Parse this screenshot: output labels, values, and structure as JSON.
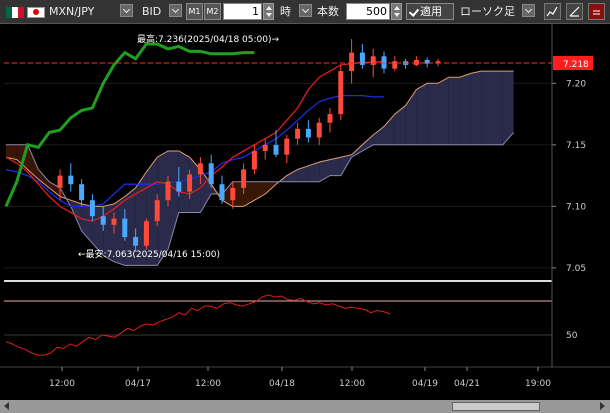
{
  "toolbar": {
    "symbol": "MXN/JPY",
    "price_type": "BID",
    "m1_label": "M1",
    "m2_label": "M2",
    "interval_value": "1",
    "interval_unit": "時",
    "count_label": "本数",
    "count_value": "500",
    "apply_label": "適用",
    "chart_type": "ローソク足"
  },
  "colors": {
    "background": "#000000",
    "up_candle": "#ff4a3a",
    "down_candle": "#4aa8ff",
    "chikou": "#1ea01e",
    "kijun": "#1c2ee0",
    "tenkan": "#e01c1c",
    "cloud_bear": "#3a1608",
    "cloud_bull": "#2a2a4a",
    "price_tag": "#ff1e1e"
  },
  "chart_data": [
    {
      "type": "line",
      "price_axis": {
        "ylim": [
          7.045,
          7.245
        ],
        "ticks": [
          "7.20",
          "7.15",
          "7.10",
          "7.05"
        ]
      },
      "current_price": "7.218",
      "annotations": {
        "high": "最高:7.236(2025/04/18 05:00)→",
        "low": "←最安:7.063(2025/04/16 15:00)"
      },
      "time_axis": {
        "labels": [
          "12:00",
          "04/17",
          "12:00",
          "04/18",
          "12:00",
          "04/19",
          "04/21",
          "19:00"
        ]
      },
      "candles": [
        [
          7.115,
          7.13,
          7.105,
          7.125
        ],
        [
          7.125,
          7.135,
          7.112,
          7.118
        ],
        [
          7.118,
          7.122,
          7.1,
          7.105
        ],
        [
          7.105,
          7.11,
          7.088,
          7.092
        ],
        [
          7.092,
          7.1,
          7.08,
          7.085
        ],
        [
          7.085,
          7.095,
          7.078,
          7.09
        ],
        [
          7.09,
          7.098,
          7.072,
          7.075
        ],
        [
          7.075,
          7.082,
          7.063,
          7.068
        ],
        [
          7.068,
          7.09,
          7.065,
          7.088
        ],
        [
          7.088,
          7.11,
          7.084,
          7.105
        ],
        [
          7.105,
          7.125,
          7.1,
          7.12
        ],
        [
          7.12,
          7.132,
          7.108,
          7.112
        ],
        [
          7.112,
          7.13,
          7.106,
          7.126
        ],
        [
          7.126,
          7.14,
          7.118,
          7.135
        ],
        [
          7.135,
          7.142,
          7.115,
          7.118
        ],
        [
          7.118,
          7.125,
          7.102,
          7.105
        ],
        [
          7.105,
          7.12,
          7.098,
          7.115
        ],
        [
          7.115,
          7.135,
          7.11,
          7.13
        ],
        [
          7.13,
          7.15,
          7.126,
          7.145
        ],
        [
          7.145,
          7.155,
          7.138,
          7.15
        ],
        [
          7.15,
          7.162,
          7.14,
          7.142
        ],
        [
          7.142,
          7.158,
          7.135,
          7.155
        ],
        [
          7.155,
          7.168,
          7.15,
          7.163
        ],
        [
          7.163,
          7.17,
          7.152,
          7.156
        ],
        [
          7.156,
          7.172,
          7.15,
          7.168
        ],
        [
          7.168,
          7.18,
          7.16,
          7.175
        ],
        [
          7.175,
          7.215,
          7.17,
          7.21
        ],
        [
          7.21,
          7.236,
          7.2,
          7.225
        ],
        [
          7.225,
          7.232,
          7.212,
          7.215
        ],
        [
          7.215,
          7.228,
          7.205,
          7.222
        ],
        [
          7.222,
          7.226,
          7.208,
          7.212
        ],
        [
          7.212,
          7.222,
          7.21,
          7.218
        ],
        [
          7.218,
          7.22,
          7.212,
          7.215
        ],
        [
          7.215,
          7.222,
          7.214,
          7.219
        ],
        [
          7.219,
          7.221,
          7.213,
          7.216
        ],
        [
          7.216,
          7.22,
          7.214,
          7.218
        ]
      ],
      "tenkan": [
        7.14,
        7.135,
        7.128,
        7.118,
        7.108,
        7.1,
        7.095,
        7.09,
        7.088,
        7.092,
        7.098,
        7.105,
        7.11,
        7.115,
        7.12,
        7.118,
        7.112,
        7.11,
        7.115,
        7.125,
        7.132,
        7.14,
        7.145,
        7.15,
        7.155,
        7.16,
        7.17,
        7.18,
        7.195,
        7.205,
        7.21,
        7.215,
        7.216,
        7.217,
        7.217,
        7.218
      ],
      "kijun": [
        7.13,
        7.128,
        7.125,
        7.12,
        7.112,
        7.105,
        7.1,
        7.1,
        7.1,
        7.102,
        7.11,
        7.118,
        7.118,
        7.118,
        7.118,
        7.12,
        7.12,
        7.122,
        7.125,
        7.128,
        7.135,
        7.138,
        7.14,
        7.145,
        7.15,
        7.155,
        7.162,
        7.17,
        7.178,
        7.185,
        7.188,
        7.19,
        7.19,
        7.19,
        7.189,
        7.189
      ],
      "chikou": [
        7.1,
        7.12,
        7.15,
        7.148,
        7.16,
        7.162,
        7.172,
        7.178,
        7.18,
        7.2,
        7.215,
        7.225,
        7.22,
        7.232,
        7.232,
        7.228,
        7.23,
        7.226,
        7.226,
        7.224,
        7.224,
        7.224,
        7.225,
        7.225
      ],
      "span_a": [
        7.14,
        7.138,
        7.13,
        7.122,
        7.115,
        7.108,
        7.105,
        7.102,
        7.1,
        7.1,
        7.102,
        7.108,
        7.115,
        7.128,
        7.14,
        7.145,
        7.145,
        7.14,
        7.13,
        7.118,
        7.105,
        7.1,
        7.1,
        7.105,
        7.11,
        7.118,
        7.125,
        7.13,
        7.133,
        7.136,
        7.138,
        7.14,
        7.142,
        7.15,
        7.158,
        7.165,
        7.175,
        7.182,
        7.195,
        7.2,
        7.2,
        7.205,
        7.205,
        7.208,
        7.21,
        7.21,
        7.21,
        7.21
      ],
      "span_b": [
        7.15,
        7.15,
        7.15,
        7.13,
        7.12,
        7.115,
        7.1,
        7.08,
        7.07,
        7.06,
        7.055,
        7.052,
        7.052,
        7.052,
        7.052,
        7.065,
        7.095,
        7.095,
        7.095,
        7.11,
        7.11,
        7.12,
        7.12,
        7.12,
        7.12,
        7.12,
        7.12,
        7.12,
        7.12,
        7.12,
        7.125,
        7.125,
        7.14,
        7.145,
        7.15,
        7.15,
        7.15,
        7.15,
        7.15,
        7.15,
        7.15,
        7.15,
        7.15,
        7.15,
        7.15,
        7.15,
        7.15,
        7.16
      ]
    },
    {
      "type": "line",
      "ticks": [
        "50"
      ],
      "rsi": [
        40,
        38,
        35,
        33,
        30,
        28,
        28,
        30,
        35,
        34,
        38,
        36,
        40,
        44,
        42,
        46,
        45,
        44,
        48,
        52,
        50,
        54,
        56,
        55,
        58,
        60,
        62,
        66,
        64,
        70,
        68,
        72,
        72,
        70,
        74,
        75,
        73,
        72,
        74,
        76,
        80,
        82,
        80,
        81,
        78,
        77,
        79,
        76,
        74,
        75,
        73,
        74,
        72,
        70,
        71,
        70,
        69,
        66,
        68,
        67,
        65
      ]
    }
  ]
}
